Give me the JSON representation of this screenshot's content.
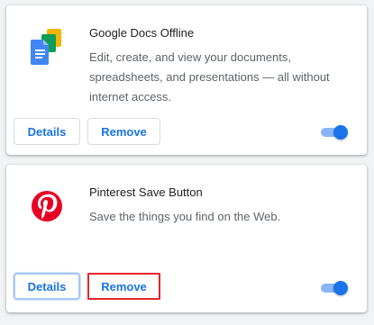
{
  "extensions": [
    {
      "name": "Google Docs Offline",
      "description": "Edit, create, and view your documents, spreadsheets, and presentations — all without internet access.",
      "icon": "google-docs-icon",
      "details_label": "Details",
      "remove_label": "Remove",
      "enabled": true
    },
    {
      "name": "Pinterest Save Button",
      "description": "Save the things you find on the Web.",
      "icon": "pinterest-icon",
      "details_label": "Details",
      "remove_label": "Remove",
      "enabled": true
    }
  ],
  "colors": {
    "accent": "#1a73e8",
    "pinterest": "#e60023",
    "highlight": "#e5272c"
  }
}
